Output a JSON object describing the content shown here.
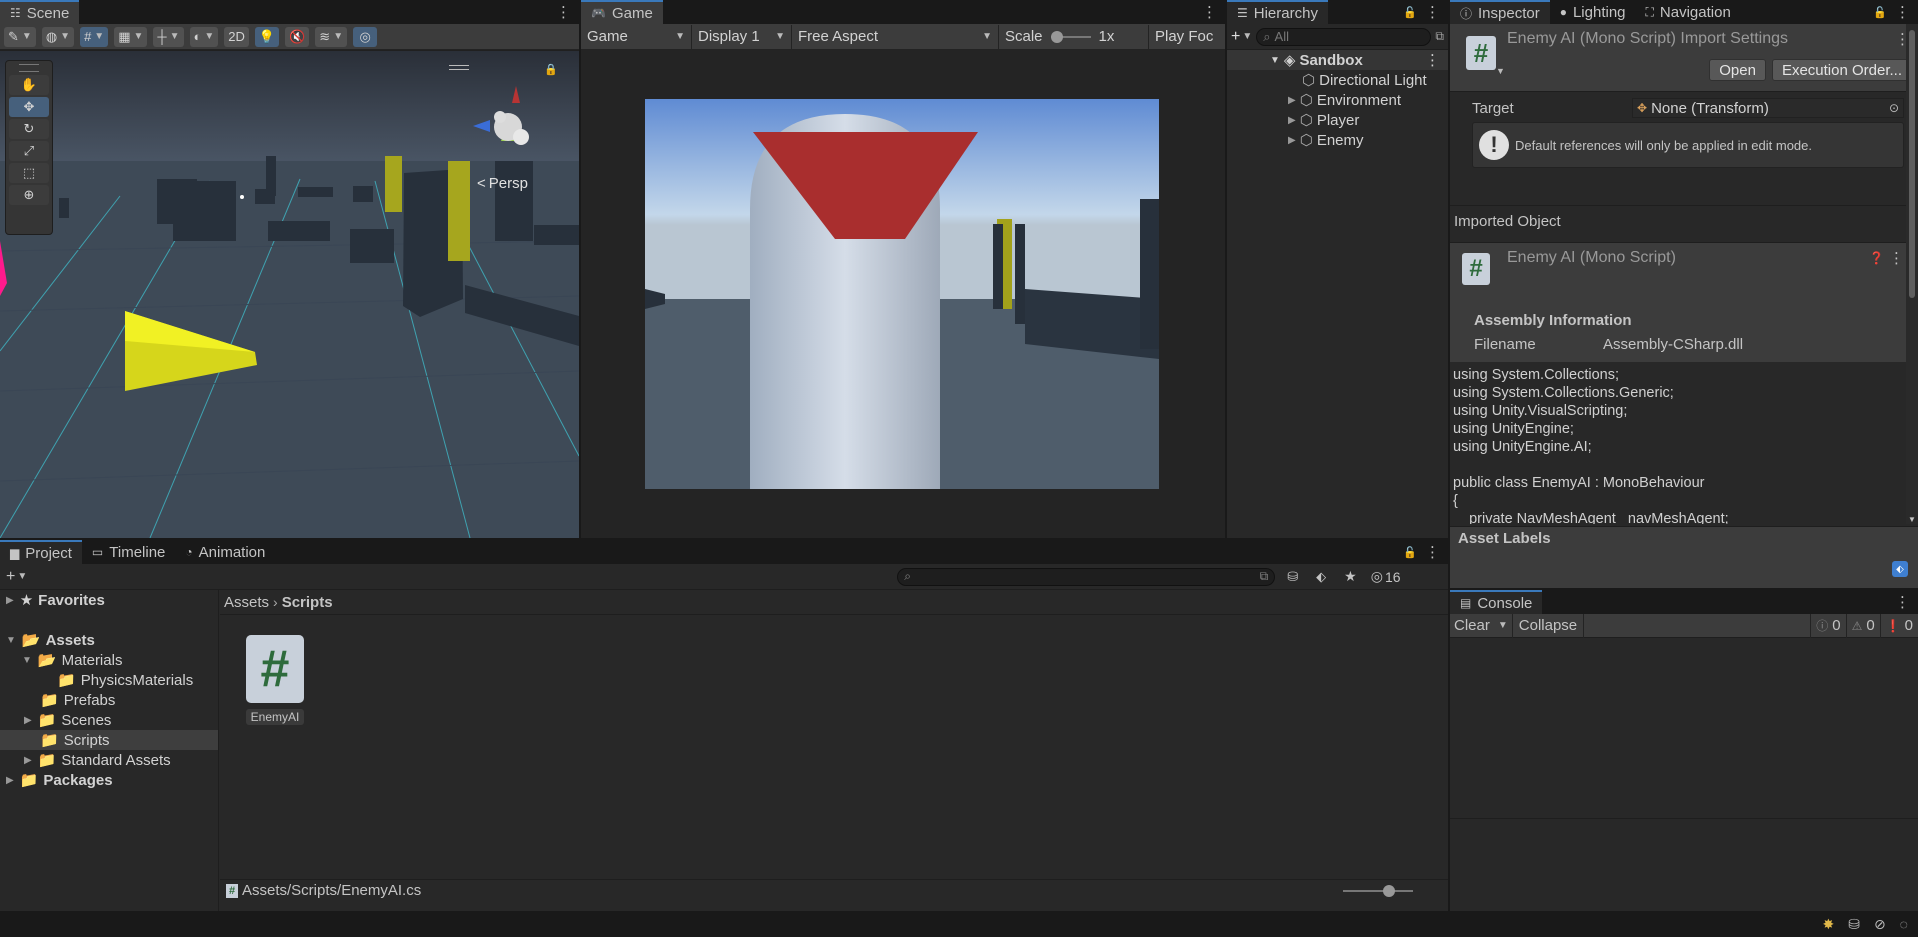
{
  "scene": {
    "tab": "Scene",
    "view_mode": "2D",
    "persp_label": "Persp",
    "gizmo_axes": {
      "y": "y",
      "x": "x",
      "z": "z"
    }
  },
  "game": {
    "tab": "Game",
    "mode": "Game",
    "display": "Display 1",
    "aspect": "Free Aspect",
    "scale_label": "Scale",
    "scale_value": "1x",
    "play_focus": "Play Foc"
  },
  "hierarchy": {
    "tab": "Hierarchy",
    "search_placeholder": "All",
    "scene_name": "Sandbox",
    "items": [
      "Directional Light",
      "Environment",
      "Player",
      "Enemy"
    ]
  },
  "inspector": {
    "tabs": [
      "Inspector",
      "Lighting",
      "Navigation"
    ],
    "title": "Enemy AI (Mono Script) Import Settings",
    "open_button": "Open",
    "execution_order_button": "Execution Order...",
    "target_label": "Target",
    "target_value": "None (Transform)",
    "warning_text": "Default references will only be applied in edit mode.",
    "imported_object_label": "Imported Object",
    "imported_object_name": "Enemy AI (Mono Script)",
    "assembly_header": "Assembly Information",
    "filename_label": "Filename",
    "filename_value": "Assembly-CSharp.dll",
    "code": "using System.Collections;\nusing System.Collections.Generic;\nusing Unity.VisualScripting;\nusing UnityEngine;\nusing UnityEngine.AI;\n\npublic class EnemyAI : MonoBehaviour\n{\n    private NavMeshAgent _navMeshAgent;",
    "asset_labels": "Asset Labels"
  },
  "project": {
    "tabs": [
      "Project",
      "Timeline",
      "Animation"
    ],
    "hidden_count": "16",
    "tree": {
      "favorites": "Favorites",
      "assets": "Assets",
      "materials": "Materials",
      "physics_materials": "PhysicsMaterials",
      "prefabs": "Prefabs",
      "scenes": "Scenes",
      "scripts": "Scripts",
      "standard_assets": "Standard Assets",
      "packages": "Packages"
    },
    "breadcrumb": [
      "Assets",
      "Scripts"
    ],
    "files": [
      {
        "name": "EnemyAI"
      }
    ],
    "status_path": "Assets/Scripts/EnemyAI.cs"
  },
  "console": {
    "tab": "Console",
    "clear": "Clear",
    "collapse": "Collapse",
    "log_count": "0",
    "warn_count": "0",
    "error_count": "0"
  },
  "colors": {
    "accent": "#3a79bb",
    "panel": "#282828",
    "toolbar": "#3c3c3c",
    "script_icon_green": "#2e6b3c"
  }
}
